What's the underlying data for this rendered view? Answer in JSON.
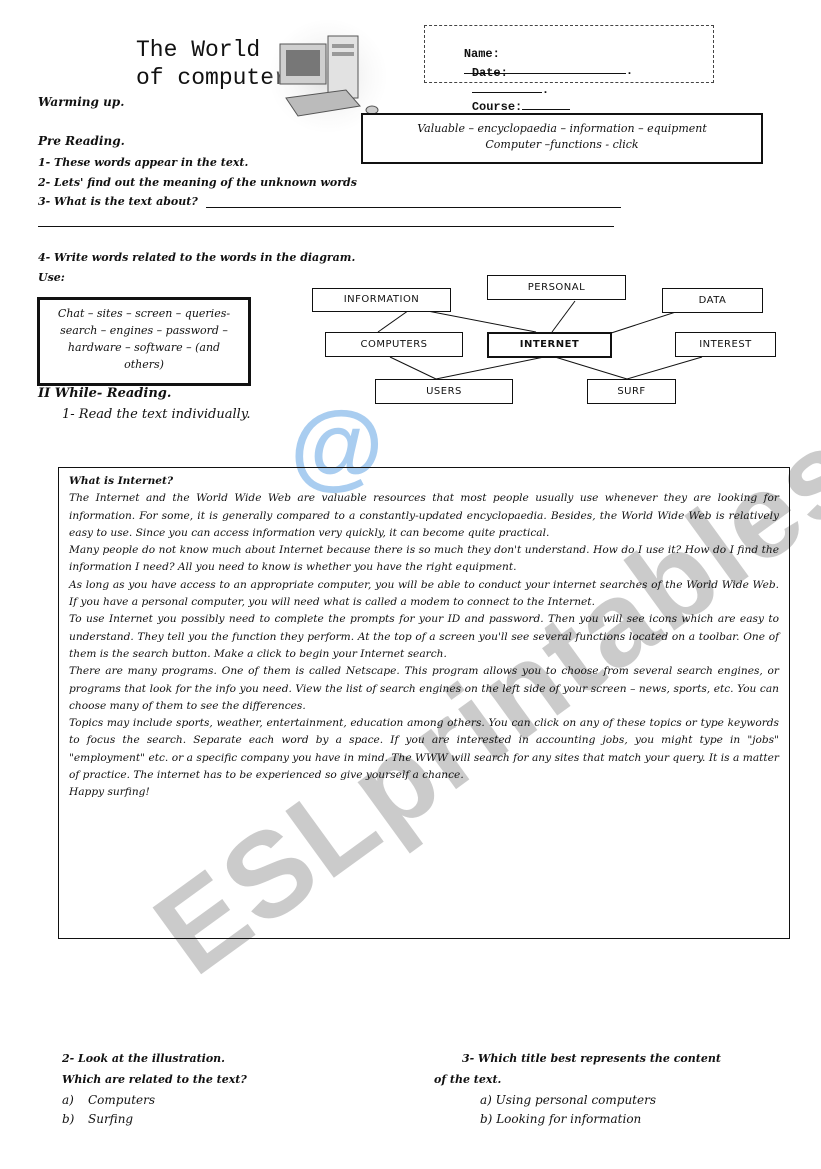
{
  "header": {
    "title_line1": "The World",
    "title_line2": "of computers",
    "illustration": "desktop-computer-illustration",
    "name_label": "Name:",
    "date_label": "Date:",
    "course_label": "Course:"
  },
  "warming_up": "Warming up.",
  "pre_reading": {
    "heading": "Pre Reading.",
    "q1": "1- These words appear in the text.",
    "q2": "2- Lets' find out the meaning of the unknown words",
    "q3": "3- What is the text about?",
    "vocab_line1": "Valuable – encyclopaedia – information – equipment",
    "vocab_line2": "Computer –functions - click"
  },
  "diagram_task": {
    "q4": "4- Write words related to the words in the diagram.",
    "use_label": "Use:",
    "use_words": "Chat – sites – screen – queries- search – engines – password – hardware – software – (and others)",
    "nodes": {
      "information": "INFORMATION",
      "personal": "PERSONAL",
      "data": "DATA",
      "computers": "COMPUTERS",
      "internet": "INTERNET",
      "interest": "INTEREST",
      "users": "USERS",
      "surf": "SURF"
    }
  },
  "while_reading": {
    "heading": "II While- Reading.",
    "step1": "1-   Read the text individually."
  },
  "article": {
    "title": "What is Internet?",
    "paragraphs": [
      "The Internet and the World Wide Web are valuable resources that most people usually use whenever they are looking for information. For some, it is generally compared to a constantly-updated encyclopaedia. Besides, the World Wide Web is relatively easy to use. Since you can access information very quickly, it can become quite practical.",
      "Many people do not know much about Internet because there is so much they don't understand. How do I use it? How do I find the information I need? All you need to know is whether you have the right equipment.",
      "As long as you have access to an appropriate computer, you will be able to conduct your internet searches of the World Wide Web. If you have a personal computer, you will need what is called a modem to connect to the Internet.",
      "To use Internet you possibly need to complete the prompts for your ID and password. Then you will see icons which are easy to understand. They tell you the function they perform. At the top of a screen you'll see several functions located on a toolbar. One of them is the search button. Make a click to begin your Internet search.",
      "There are many programs. One of them is called Netscape. This program allows you to choose from several search engines, or programs that look for the info you need. View the list of search engines on the left side of your screen – news, sports, etc. You can choose many of them to see the differences.",
      "Topics may include sports, weather, entertainment, education among others. You can click on any of these topics or type keywords to focus the search. Separate each word by a space. If you are interested in accounting jobs, you might type in \"jobs\" \"employment\" etc. or a specific company you have in mind. The WWW will search for any sites that match your query. It is a matter of practice. The internet has to be experienced so give yourself a chance.",
      "Happy surfing!"
    ]
  },
  "question2": {
    "line1": "2-  Look at the illustration.",
    "line2": "Which are related to the text?",
    "options": [
      {
        "letter": "a)",
        "text": "Computers"
      },
      {
        "letter": "b)",
        "text": "Surfing"
      }
    ]
  },
  "question3": {
    "line1": "3- Which title best represents the content",
    "line2": "of the text.",
    "options": [
      {
        "letter": "a)",
        "text": "Using personal computers"
      },
      {
        "letter": "b)",
        "text": "Looking for information"
      }
    ]
  },
  "watermark": {
    "text": "ESLprintables.com",
    "at_symbol": "@",
    "at_color": "#a9cdf0"
  }
}
